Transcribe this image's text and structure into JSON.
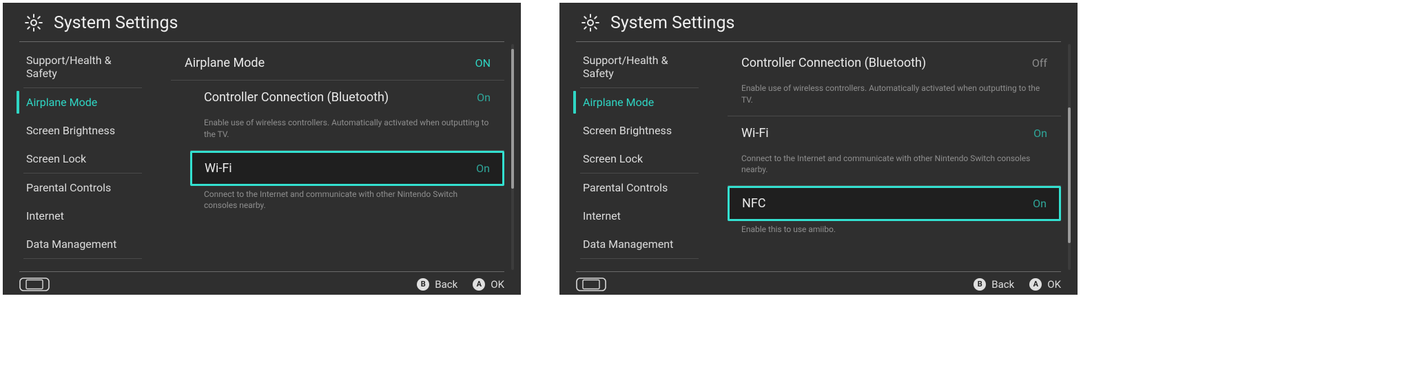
{
  "screens": [
    {
      "title": "System Settings",
      "sidebar": {
        "groups": [
          {
            "items": [
              {
                "label": "Support/Health & Safety",
                "selected": false
              }
            ]
          },
          {
            "items": [
              {
                "label": "Airplane Mode",
                "selected": true
              },
              {
                "label": "Screen Brightness",
                "selected": false
              },
              {
                "label": "Screen Lock",
                "selected": false
              }
            ]
          },
          {
            "items": [
              {
                "label": "Parental Controls",
                "selected": false
              },
              {
                "label": "Internet",
                "selected": false
              },
              {
                "label": "Data Management",
                "selected": false
              }
            ]
          }
        ]
      },
      "main": [
        {
          "kind": "row",
          "indent": false,
          "label": "Airplane Mode",
          "value": "ON",
          "value_style": "bright",
          "highlight": false,
          "border": true
        },
        {
          "kind": "row",
          "indent": true,
          "label": "Controller Connection (Bluetooth)",
          "value": "On",
          "value_style": "dim",
          "highlight": false,
          "border": false
        },
        {
          "kind": "desc",
          "indent": true,
          "text": "Enable use of wireless controllers. Automatically activated when outputting to the TV.",
          "border": true
        },
        {
          "kind": "row",
          "indent": true,
          "label": "Wi-Fi",
          "value": "On",
          "value_style": "dim",
          "highlight": true,
          "border": false
        },
        {
          "kind": "desc",
          "indent": true,
          "text": "Connect to the Internet and communicate with other Nintendo Switch consoles nearby.",
          "border": false
        }
      ],
      "scroll": {
        "top_pct": 2,
        "height_pct": 62
      },
      "footer": {
        "back": {
          "glyph": "B",
          "label": "Back"
        },
        "ok": {
          "glyph": "A",
          "label": "OK"
        }
      }
    },
    {
      "title": "System Settings",
      "sidebar": {
        "groups": [
          {
            "items": [
              {
                "label": "Support/Health & Safety",
                "selected": false
              }
            ]
          },
          {
            "items": [
              {
                "label": "Airplane Mode",
                "selected": true
              },
              {
                "label": "Screen Brightness",
                "selected": false
              },
              {
                "label": "Screen Lock",
                "selected": false
              }
            ]
          },
          {
            "items": [
              {
                "label": "Parental Controls",
                "selected": false
              },
              {
                "label": "Internet",
                "selected": false
              },
              {
                "label": "Data Management",
                "selected": false
              }
            ]
          }
        ]
      },
      "main": [
        {
          "kind": "row",
          "indent": false,
          "label": "Controller Connection (Bluetooth)",
          "value": "Off",
          "value_style": "off",
          "highlight": false,
          "border": false
        },
        {
          "kind": "desc",
          "indent": false,
          "text": "Enable use of wireless controllers. Automatically activated when outputting to the TV.",
          "border": true
        },
        {
          "kind": "row",
          "indent": false,
          "label": "Wi-Fi",
          "value": "On",
          "value_style": "dim",
          "highlight": false,
          "border": false
        },
        {
          "kind": "desc",
          "indent": false,
          "text": "Connect to the Internet and communicate with other Nintendo Switch consoles nearby.",
          "border": true
        },
        {
          "kind": "row",
          "indent": false,
          "label": "NFC",
          "value": "On",
          "value_style": "dim",
          "highlight": true,
          "border": false
        },
        {
          "kind": "desc",
          "indent": false,
          "text": "Enable this to use amiibo.",
          "border": false
        }
      ],
      "scroll": {
        "top_pct": 28,
        "height_pct": 60
      },
      "footer": {
        "back": {
          "glyph": "B",
          "label": "Back"
        },
        "ok": {
          "glyph": "A",
          "label": "OK"
        }
      }
    }
  ]
}
